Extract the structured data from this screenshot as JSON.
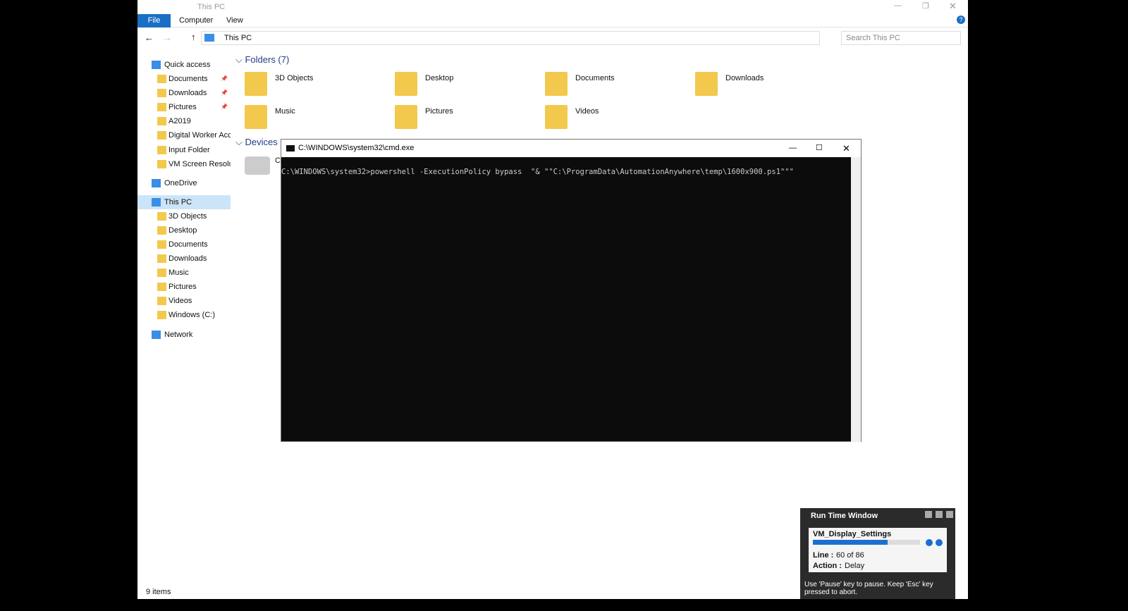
{
  "explorer": {
    "title": "This PC",
    "ribbon_tabs": [
      "File",
      "Computer",
      "View"
    ],
    "address": "This PC",
    "search_placeholder": "Search This PC",
    "nav": [
      {
        "label": "Quick access",
        "top": true
      },
      {
        "label": "Documents",
        "pinned": true
      },
      {
        "label": "Downloads",
        "pinned": true
      },
      {
        "label": "Pictures",
        "pinned": true
      },
      {
        "label": "A2019"
      },
      {
        "label": "Digital Worker Acc"
      },
      {
        "label": "Input Folder"
      },
      {
        "label": "VM Screen Resoluti"
      },
      {
        "label": "OneDrive",
        "top": true
      },
      {
        "label": "This PC",
        "top": true,
        "selected": true
      },
      {
        "label": "3D Objects"
      },
      {
        "label": "Desktop"
      },
      {
        "label": "Documents"
      },
      {
        "label": "Downloads"
      },
      {
        "label": "Music"
      },
      {
        "label": "Pictures"
      },
      {
        "label": "Videos"
      },
      {
        "label": "Windows (C:)"
      },
      {
        "label": "Network",
        "top": true
      }
    ],
    "folders_header": "Folders (7)",
    "folders": [
      "3D Objects",
      "Desktop",
      "Documents",
      "Downloads",
      "Music",
      "Pictures",
      "Videos"
    ],
    "devices_header": "Devices a",
    "device_label": "C",
    "status": "9 items"
  },
  "cmd": {
    "title": "C:\\WINDOWS\\system32\\cmd.exe",
    "line": "C:\\WINDOWS\\system32>powershell -ExecutionPolicy bypass  \"& \"\"C:\\ProgramData\\AutomationAnywhere\\temp\\1600x900.ps1\"\"\""
  },
  "runtime": {
    "title": "Run Time Window",
    "task": "VM_Display_Settings",
    "progress_percent": 70,
    "line_label": "Line :",
    "line_value": "60 of 86",
    "action_label": "Action :",
    "action_value": "Delay",
    "hint": "Use 'Pause' key to pause. Keep 'Esc' key pressed to abort."
  }
}
